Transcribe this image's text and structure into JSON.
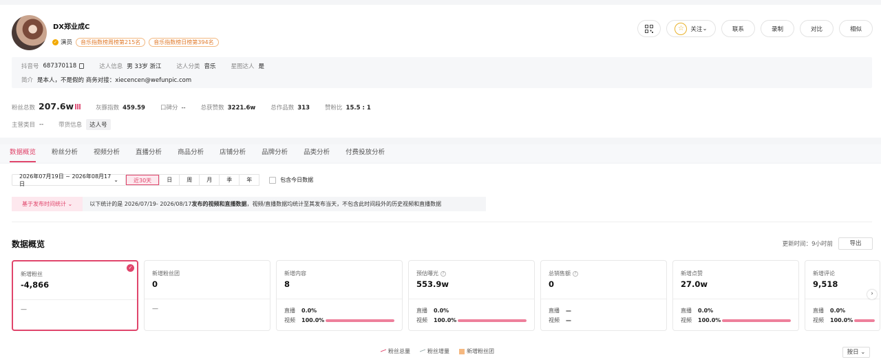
{
  "profile": {
    "name": "DX郑业成C",
    "role": "演员",
    "tags": [
      "音乐指数榜周榜第215名",
      "音乐指数榜日榜第394名"
    ],
    "actions": {
      "follow": "关注",
      "contact": "联系",
      "record": "录制",
      "compare": "对比",
      "similar": "相似"
    },
    "info": {
      "douyin_label": "抖音号",
      "douyin_id": "687370118",
      "person_label": "达人信息",
      "person_value": "男 33岁 浙江",
      "category_label": "达人分类",
      "category_value": "音乐",
      "star_label": "星图达人",
      "star_value": "是",
      "bio_label": "简介",
      "bio_value": "是本人，不是假的 商务对接：xiecencen@wefunpic.com"
    },
    "stats": {
      "fans_label": "粉丝总数",
      "fans_value": "207.6w",
      "gray_label": "灰豚指数",
      "gray_value": "459.59",
      "rep_label": "口碑分",
      "rep_value": "--",
      "likes_label": "总获赞数",
      "likes_value": "3221.6w",
      "works_label": "总作品数",
      "works_value": "313",
      "ratio_label": "赞粉比",
      "ratio_value": "15.5 : 1"
    },
    "category": {
      "main_label": "主营类目",
      "main_value": "--",
      "goods_label": "带货信息",
      "goods_value": "达人号"
    }
  },
  "tabs": [
    "数据概览",
    "粉丝分析",
    "视频分析",
    "直播分析",
    "商品分析",
    "店铺分析",
    "品牌分析",
    "品类分析",
    "付费投放分析"
  ],
  "filters": {
    "date_range": "2026年07月19日 ~ 2026年08月17日",
    "periods": [
      "近30天",
      "日",
      "周",
      "月",
      "季",
      "年"
    ],
    "include_today": "包含今日数据"
  },
  "notice": {
    "basis": "基于发布时间统计",
    "prefix": "以下统计的是 2026/07/19- 2026/08/17 ",
    "bold": "发布的视频和直播数据",
    "suffix": "，视频/直播数据均统计至其发布当天，不包含此时间段外的历史视频和直播数据"
  },
  "overview": {
    "title": "数据概览",
    "update": "更新时间：9小时前",
    "export": "导出",
    "cards": [
      {
        "label": "新增粉丝",
        "value": "-4,866",
        "foot": "—"
      },
      {
        "label": "新增粉丝团",
        "value": "0",
        "foot": "—"
      },
      {
        "label": "新增内容",
        "value": "8",
        "live_label": "直播",
        "live_pct": "0.0%",
        "video_label": "视频",
        "video_pct": "100.0%"
      },
      {
        "label": "预估曝光",
        "value": "553.9w",
        "live_label": "直播",
        "live_pct": "0.0%",
        "video_label": "视频",
        "video_pct": "100.0%"
      },
      {
        "label": "总销售额",
        "value": "0",
        "live_label": "直播",
        "live_pct": "—",
        "video_label": "视频",
        "video_pct": "—"
      },
      {
        "label": "新增点赞",
        "value": "27.0w",
        "live_label": "直播",
        "live_pct": "0.0%",
        "video_label": "视频",
        "video_pct": "100.0%"
      },
      {
        "label": "新增评论",
        "value": "9,518",
        "live_label": "直播",
        "live_pct": "0.0%",
        "video_label": "视频",
        "video_pct": "100.0%"
      }
    ]
  },
  "legend": [
    "粉丝总量",
    "粉丝增量",
    "新增粉丝团"
  ],
  "granularity": "按日",
  "colors": {
    "accent": "#e0456b",
    "bar": "#ee7f9b",
    "tag": "#e07b2c"
  }
}
